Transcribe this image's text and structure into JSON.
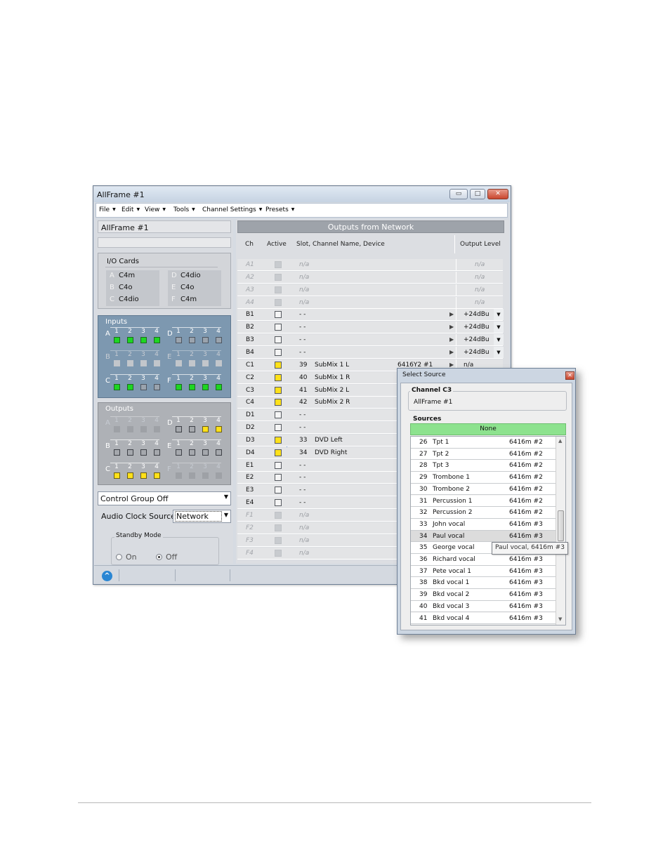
{
  "window": {
    "title": "AllFrame #1",
    "min_glyph": "▭",
    "max_glyph": "□",
    "close_glyph": "✕"
  },
  "menu": [
    {
      "label": "File"
    },
    {
      "label": "Edit"
    },
    {
      "label": "View"
    },
    {
      "label": "Tools"
    },
    {
      "label": "Channel Settings"
    },
    {
      "label": "Presets"
    }
  ],
  "menu_arrow": "▼",
  "left": {
    "device_name": "AllFrame #1",
    "io_cards_title": "I/O Cards",
    "cards_left": [
      {
        "letter": "A",
        "model": "C4m"
      },
      {
        "letter": "B",
        "model": "C4o"
      },
      {
        "letter": "C",
        "model": "C4dio"
      }
    ],
    "cards_right": [
      {
        "letter": "D",
        "model": "C4dio"
      },
      {
        "letter": "E",
        "model": "C4o"
      },
      {
        "letter": "F",
        "model": "C4m"
      }
    ],
    "inputs_title": "Inputs",
    "outputs_title": "Outputs",
    "port_numbers": [
      "1",
      "2",
      "3",
      "4"
    ],
    "inputs": {
      "A": {
        "letter": "A",
        "leds": [
          "green",
          "green",
          "green",
          "green"
        ],
        "dim": false
      },
      "B": {
        "letter": "B",
        "leds": [
          "dis",
          "dis",
          "dis",
          "dis"
        ],
        "dim": true
      },
      "C": {
        "letter": "C",
        "leds": [
          "green",
          "green",
          "off",
          "off"
        ],
        "dim": false
      },
      "D": {
        "letter": "D",
        "leds": [
          "off",
          "off",
          "off",
          "off"
        ],
        "dim": false
      },
      "E": {
        "letter": "E",
        "leds": [
          "dis",
          "dis",
          "dis",
          "dis"
        ],
        "dim": true
      },
      "F": {
        "letter": "F",
        "leds": [
          "green",
          "green",
          "green",
          "green"
        ],
        "dim": false
      }
    },
    "outputs": {
      "A": {
        "letter": "A",
        "leds": [
          "disdark",
          "disdark",
          "disdark",
          "disdark"
        ],
        "dim": true
      },
      "B": {
        "letter": "B",
        "leds": [
          "offdark",
          "offdark",
          "offdark",
          "offdark"
        ],
        "dim": false
      },
      "C": {
        "letter": "C",
        "leds": [
          "yellow",
          "yellow",
          "yellow",
          "yellow"
        ],
        "dim": false
      },
      "D": {
        "letter": "D",
        "leds": [
          "offdark",
          "offdark",
          "yellow",
          "yellow"
        ],
        "dim": false
      },
      "E": {
        "letter": "E",
        "leds": [
          "offdark",
          "offdark",
          "offdark",
          "offdark"
        ],
        "dim": false
      },
      "F": {
        "letter": "F",
        "leds": [
          "disdark",
          "disdark",
          "disdark",
          "disdark"
        ],
        "dim": true
      }
    },
    "control_group": "Control Group Off",
    "audio_clock_label": "Audio Clock Source",
    "audio_clock_value": "Network",
    "standby_title": "Standby Mode",
    "standby_on": "On",
    "standby_off": "Off",
    "standby_selected": "Off"
  },
  "right": {
    "header": "Outputs from Network",
    "col_ch": "Ch",
    "col_active": "Active",
    "col_slot": "Slot, Channel Name, Device",
    "col_level": "Output Level",
    "rows": [
      {
        "ch": "A1",
        "disabled": true,
        "active": "dis",
        "slot": "n/a",
        "level": "n/a"
      },
      {
        "ch": "A2",
        "disabled": true,
        "active": "dis",
        "slot": "n/a",
        "level": "n/a"
      },
      {
        "ch": "A3",
        "disabled": true,
        "active": "dis",
        "slot": "n/a",
        "level": "n/a"
      },
      {
        "ch": "A4",
        "disabled": true,
        "active": "dis",
        "slot": "n/a",
        "level": "n/a"
      },
      {
        "ch": "B1",
        "disabled": false,
        "active": "empty",
        "slot": "- -",
        "play": true,
        "level": "+24dBu",
        "dropdown": true
      },
      {
        "ch": "B2",
        "disabled": false,
        "active": "empty",
        "slot": "- -",
        "play": true,
        "level": "+24dBu",
        "dropdown": true
      },
      {
        "ch": "B3",
        "disabled": false,
        "active": "empty",
        "slot": "- -",
        "play": true,
        "level": "+24dBu",
        "dropdown": true
      },
      {
        "ch": "B4",
        "disabled": false,
        "active": "empty",
        "slot": "- -",
        "play": true,
        "level": "+24dBu",
        "dropdown": true
      },
      {
        "ch": "C1",
        "disabled": false,
        "active": "yellow",
        "slot": "39",
        "name": "SubMix 1 L",
        "device": "6416Y2 #1",
        "play": true,
        "level": "n/a"
      },
      {
        "ch": "C2",
        "disabled": false,
        "active": "yellow",
        "slot": "40",
        "name": "SubMix 1 R"
      },
      {
        "ch": "C3",
        "disabled": false,
        "active": "yellow",
        "slot": "41",
        "name": "SubMix 2 L"
      },
      {
        "ch": "C4",
        "disabled": false,
        "active": "yellow",
        "slot": "42",
        "name": "SubMix 2 R"
      },
      {
        "ch": "D1",
        "disabled": false,
        "active": "empty",
        "slot": "- -"
      },
      {
        "ch": "D2",
        "disabled": false,
        "active": "empty",
        "slot": "- -"
      },
      {
        "ch": "D3",
        "disabled": false,
        "active": "yellow",
        "slot": "33",
        "name": "DVD Left"
      },
      {
        "ch": "D4",
        "disabled": false,
        "active": "yellow",
        "slot": "34",
        "name": "DVD Right"
      },
      {
        "ch": "E1",
        "disabled": false,
        "active": "empty",
        "slot": "- -"
      },
      {
        "ch": "E2",
        "disabled": false,
        "active": "empty",
        "slot": "- -"
      },
      {
        "ch": "E3",
        "disabled": false,
        "active": "empty",
        "slot": "- -"
      },
      {
        "ch": "E4",
        "disabled": false,
        "active": "empty",
        "slot": "- -"
      },
      {
        "ch": "F1",
        "disabled": true,
        "active": "dis",
        "slot": "n/a"
      },
      {
        "ch": "F2",
        "disabled": true,
        "active": "dis",
        "slot": "n/a"
      },
      {
        "ch": "F3",
        "disabled": true,
        "active": "dis",
        "slot": "n/a"
      },
      {
        "ch": "F4",
        "disabled": true,
        "active": "dis",
        "slot": "n/a"
      }
    ]
  },
  "popup": {
    "title": "Select Source",
    "close_glyph": "✕",
    "channel_legend": "Channel C3",
    "channel_device": "AllFrame #1",
    "sources_legend": "Sources",
    "none_label": "None",
    "rows": [
      {
        "n": "26",
        "s": "Tpt 1",
        "d": "6416m #2"
      },
      {
        "n": "27",
        "s": "Tpt 2",
        "d": "6416m #2"
      },
      {
        "n": "28",
        "s": "Tpt 3",
        "d": "6416m #2"
      },
      {
        "n": "29",
        "s": "Trombone 1",
        "d": "6416m #2"
      },
      {
        "n": "30",
        "s": "Trombone 2",
        "d": "6416m #2"
      },
      {
        "n": "31",
        "s": "Percussion 1",
        "d": "6416m #2"
      },
      {
        "n": "32",
        "s": "Percussion 2",
        "d": "6416m #2"
      },
      {
        "n": "33",
        "s": "John vocal",
        "d": "6416m #3"
      },
      {
        "n": "34",
        "s": "Paul vocal",
        "d": "6416m #3",
        "hl": true
      },
      {
        "n": "35",
        "s": "George vocal",
        "d": ""
      },
      {
        "n": "36",
        "s": "Richard vocal",
        "d": "6416m #3"
      },
      {
        "n": "37",
        "s": "Pete vocal 1",
        "d": "6416m #3"
      },
      {
        "n": "38",
        "s": "Bkd vocal 1",
        "d": "6416m #3"
      },
      {
        "n": "39",
        "s": "Bkd vocal 2",
        "d": "6416m #3"
      },
      {
        "n": "40",
        "s": "Bkd vocal 3",
        "d": "6416m #3"
      },
      {
        "n": "41",
        "s": "Bkd vocal 4",
        "d": "6416m #3"
      }
    ],
    "tooltip": "Paul vocal, 6416m #3"
  },
  "colors": {
    "led_green": "#1dd622",
    "led_yellow": "#ffe11a",
    "inputs_bg": "#7d98b0",
    "none_green": "#8de28e"
  }
}
